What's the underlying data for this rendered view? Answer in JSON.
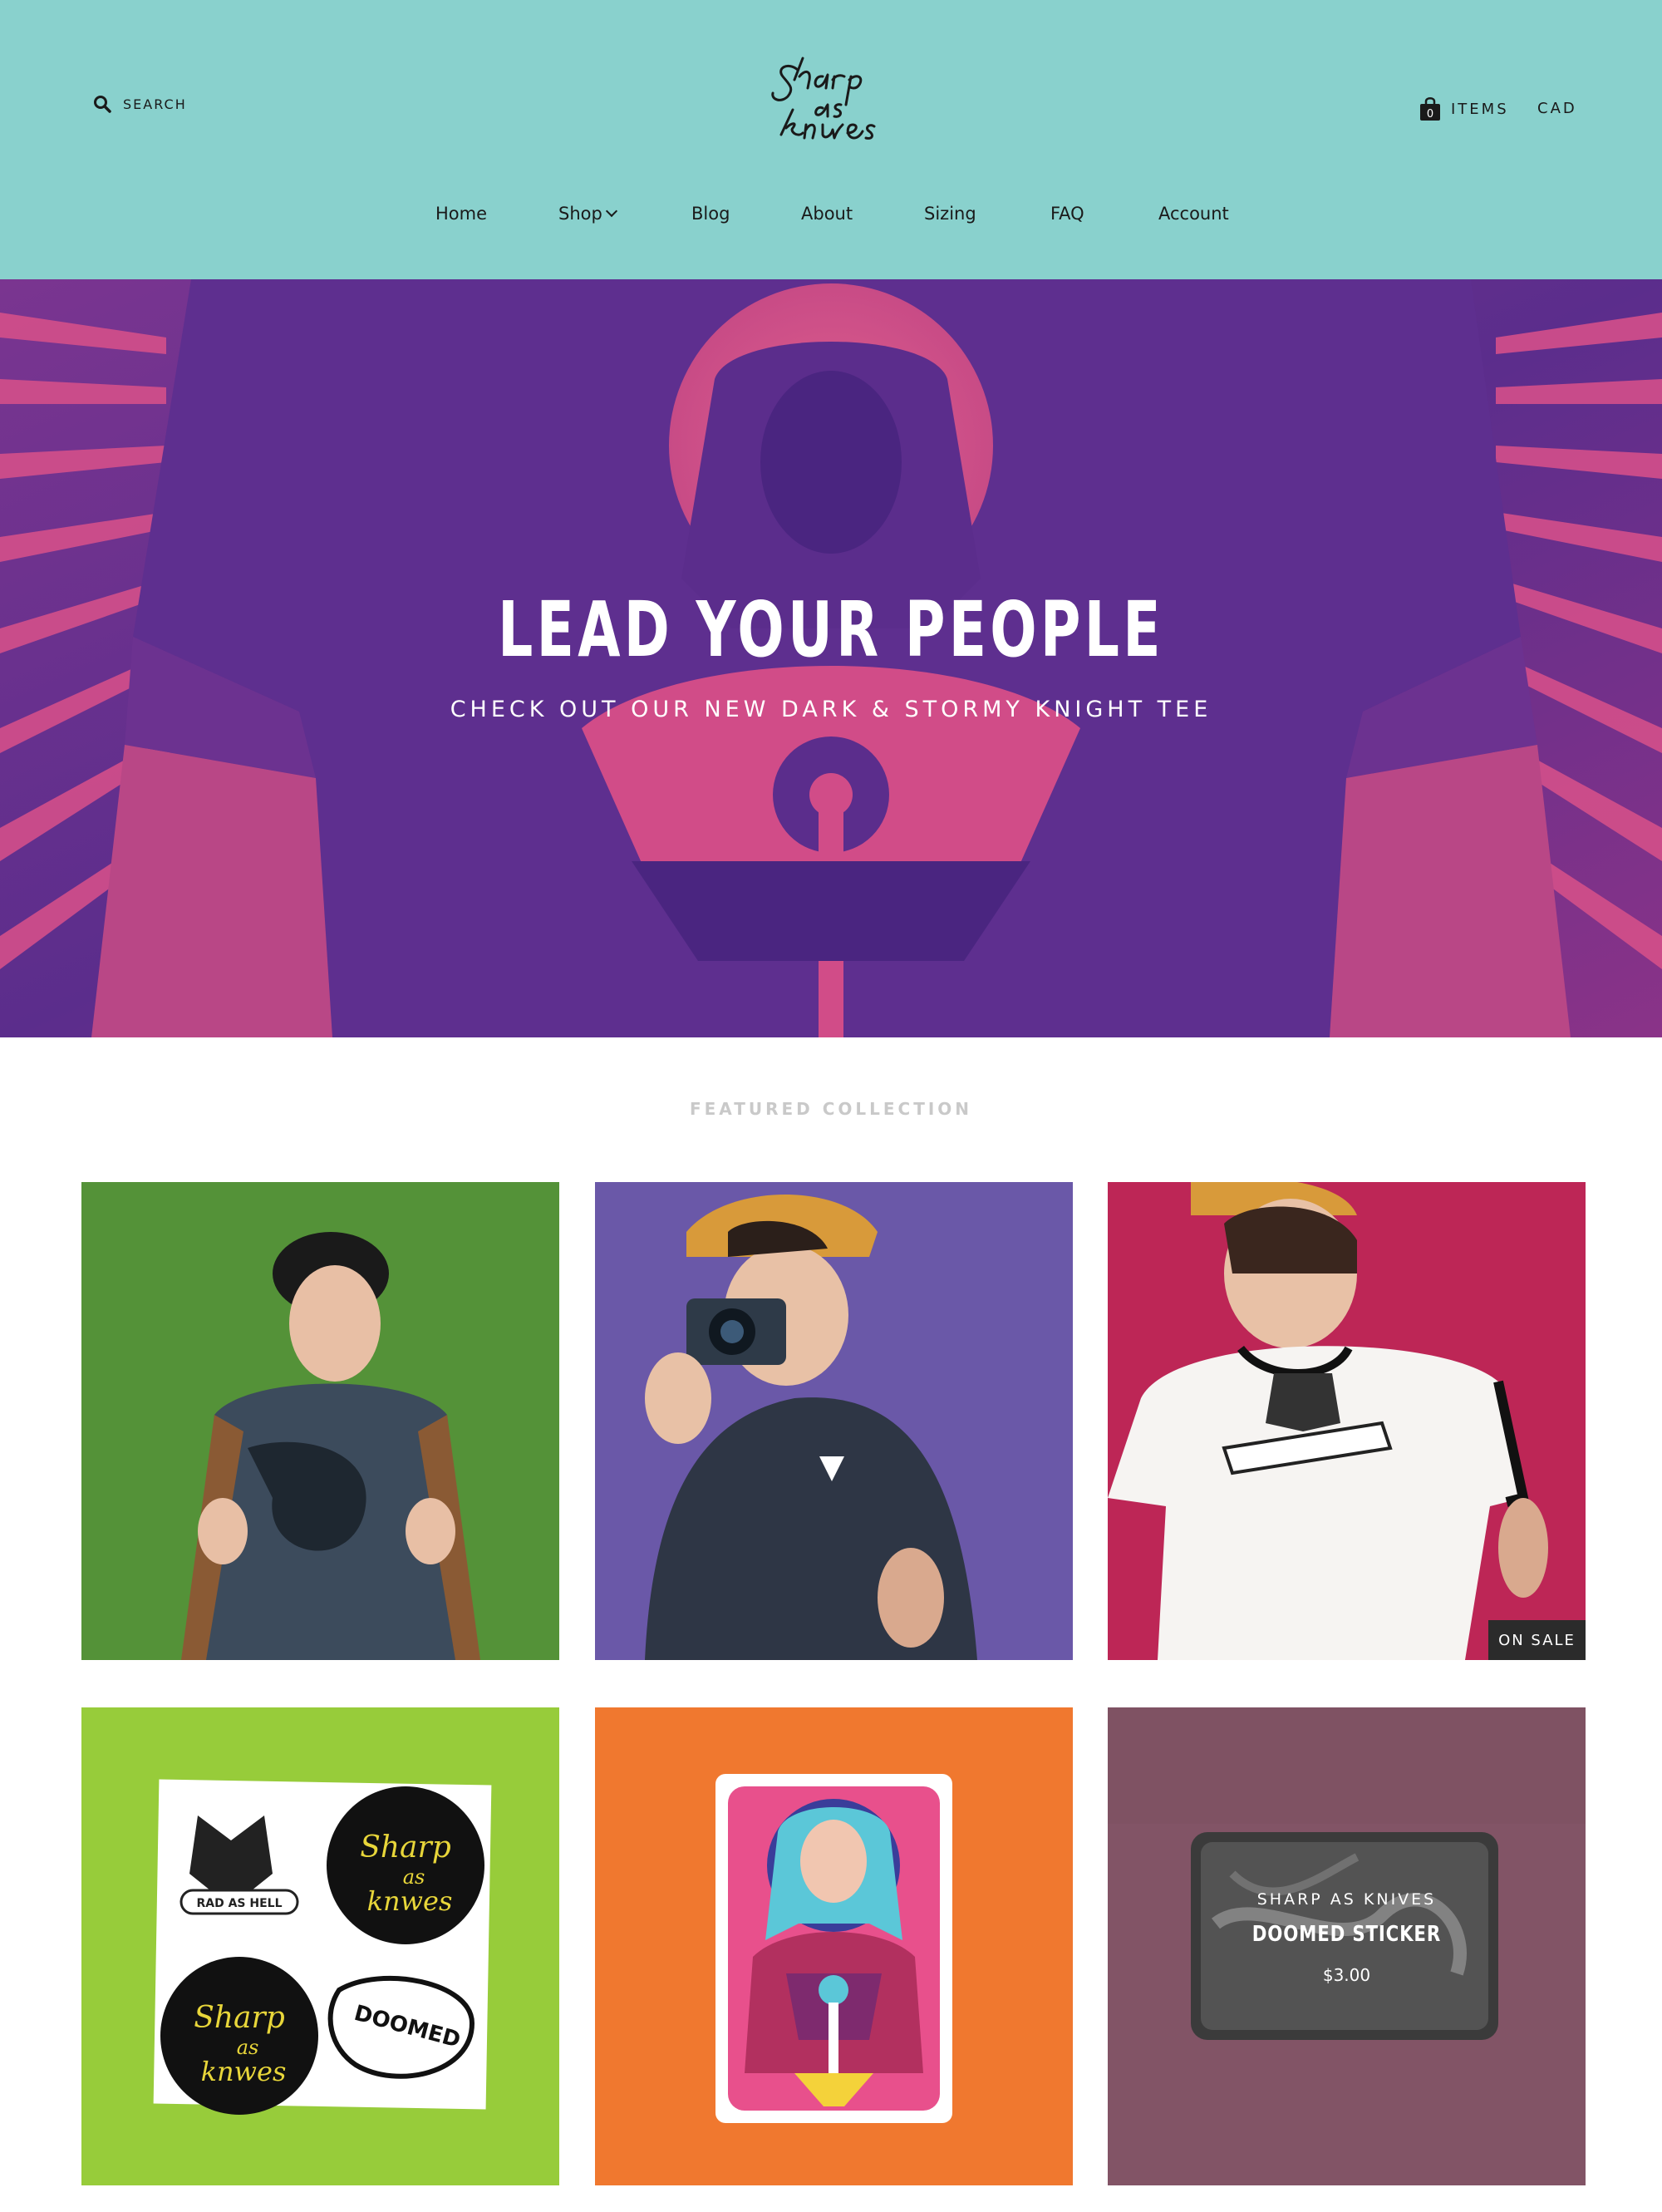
{
  "header": {
    "search_label": "SEARCH",
    "logo_text": [
      "Sharp",
      "as",
      "knwes"
    ],
    "cart_count": "0",
    "cart_label": "ITEMS",
    "currency": "CAD",
    "nav": [
      {
        "label": "Home"
      },
      {
        "label": "Shop"
      },
      {
        "label": "Blog"
      },
      {
        "label": "About"
      },
      {
        "label": "Sizing"
      },
      {
        "label": "FAQ"
      },
      {
        "label": "Account"
      }
    ]
  },
  "hero": {
    "title": "LEAD YOUR PEOPLE",
    "subtitle": "CHECK OUT OUR NEW DARK & STORMY KNIGHT TEE"
  },
  "featured": {
    "heading": "FEATURED COLLECTION",
    "products": [
      {
        "image": "person-green-backdrop-doomed-tee"
      },
      {
        "image": "person-purple-backdrop-camera"
      },
      {
        "image": "person-pink-backdrop-rad-as-hell-ringer-tee",
        "badge": "ON SALE"
      },
      {
        "image": "sticker-sheet-on-lime",
        "sticker_texts": [
          "RAD AS HELL",
          "DOOMED"
        ]
      },
      {
        "image": "knight-print-on-orange"
      },
      {
        "image": "doomed-sticker-on-mauve",
        "vendor": "SHARP AS KNIVES",
        "title": "DOOMED STICKER",
        "price": "$3.00"
      }
    ]
  },
  "colors": {
    "header_bg": "#89d1cd",
    "hero_pink": "#d94f86",
    "hero_purple": "#5b2d8c",
    "badge_bg": "#2b2b2b",
    "heading_gray": "#c9c9c9"
  }
}
